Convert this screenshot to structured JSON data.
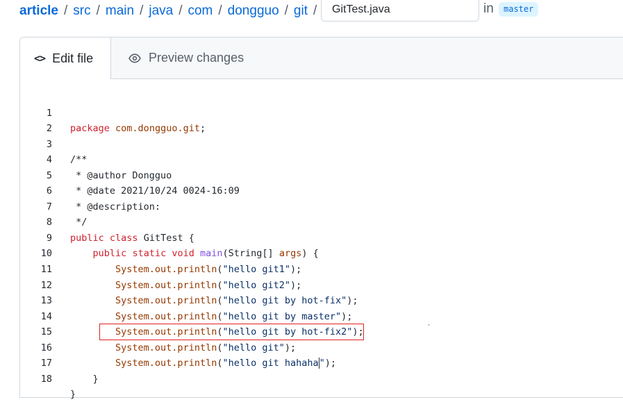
{
  "breadcrumb": {
    "root": "article",
    "parts": [
      "src",
      "main",
      "java",
      "com",
      "dongguo",
      "git"
    ],
    "separator": "/"
  },
  "filename": {
    "value": "GitTest.java"
  },
  "branch": {
    "in_label": "in",
    "name": "master"
  },
  "tabs": {
    "edit": {
      "icon": "code-icon",
      "label": "Edit file"
    },
    "preview": {
      "icon": "eye-icon",
      "label": "Preview changes"
    }
  },
  "code": {
    "line_numbers": [
      "1",
      "2",
      "3",
      "4",
      "5",
      "6",
      "7",
      "8",
      "9",
      "10",
      "11",
      "12",
      "13",
      "14",
      "15",
      "16",
      "17",
      "18"
    ],
    "lines": [
      "package com.dongguo.git;",
      "",
      "/**",
      " * @author Dongguo",
      " * @date 2021/10/24 0024-16:09",
      " * @description:",
      " */",
      "public class GitTest {",
      "    public static void main(String[] args) {",
      "        System.out.println(\"hello git1\");",
      "        System.out.println(\"hello git2\");",
      "        System.out.println(\"hello git by hot-fix\");",
      "        System.out.println(\"hello git by master\");",
      "        System.out.println(\"hello git by hot-fix2\");",
      "        System.out.println(\"hello git\");",
      "        System.out.println(\"hello git hahaha\");",
      "    }",
      "}"
    ]
  },
  "colors": {
    "link": "#0969da",
    "keyword": "#cf222e",
    "class_ref": "#953800",
    "function": "#8250df",
    "string": "#0a3069",
    "highlight_border": "#e02020"
  }
}
